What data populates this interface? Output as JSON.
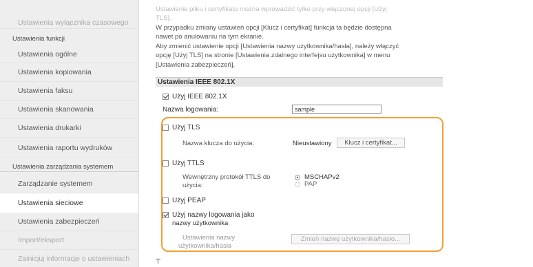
{
  "sidebar": {
    "items": [
      {
        "label": "Ustawienia wyłącznika czasowego",
        "state": "faint"
      },
      {
        "header": "Ustawienia funkcji"
      },
      {
        "label": "Ustawienia ogólne"
      },
      {
        "label": "Ustawienia kopiowania"
      },
      {
        "label": "Ustawienia faksu"
      },
      {
        "label": "Ustawienia skanowania"
      },
      {
        "label": "Ustawienia drukarki"
      },
      {
        "label": "Ustawienia raportu wydruków"
      },
      {
        "header": "Ustawienia zarządzania systemem"
      },
      {
        "label": "Zarządzanie systemem"
      },
      {
        "label": "Ustawienia sieciowe",
        "state": "active"
      },
      {
        "label": "Ustawienia zabezpieczeń"
      },
      {
        "label": "Import/eksport",
        "state": "faint"
      },
      {
        "label": "Zainicjuj informacje o ustawieniach",
        "state": "faint"
      }
    ]
  },
  "description": {
    "lines": [
      "Ustawienie pliku i certyfikatu można wprowadzić tylko przy włączonej opcji [Użyj",
      "TLS].",
      "W przypadku zmiany ustawień opcji [Klucz i certyfikat] funkcja ta będzie dostępna",
      "nawet po anulowaniu na tym ekranie.",
      "Aby zmienić ustawienie opcji [Ustawienia nazwy użytkownika/hasła], należy włączyć",
      "opcję [Użyj TLS] na stronie [Ustawienia zdalnego interfejsu użytkownika] w menu",
      "[Ustawienia zabezpieczeń]."
    ]
  },
  "section": {
    "title": "Ustawienia IEEE 802.1X"
  },
  "form": {
    "use_ieee": {
      "label": "Użyj IEEE 802.1X",
      "checked": true
    },
    "login_name": {
      "label": "Nazwa logowania:",
      "value": "sample"
    },
    "use_tls": {
      "label": "Użyj TLS",
      "checked": false
    },
    "key_name": {
      "label": "Nazwa klucza do użycia:",
      "value": "Nieustawiony",
      "button": "Klucz i certyfikat..."
    },
    "use_ttls": {
      "label": "Użyj TTLS",
      "checked": false
    },
    "ttls_protocol": {
      "label_line1": "Wewnętrzny protokół TTLS do",
      "label_line2": "użycia:",
      "options": [
        {
          "label": "MSCHAPv2",
          "checked": true
        },
        {
          "label": "PAP",
          "checked": false
        }
      ]
    },
    "use_peap": {
      "label": "Użyj PEAP",
      "checked": false
    },
    "use_login_as_user": {
      "label_line1": "Użyj nazwy logowania jako",
      "label_line2": "nazwy użytkownika",
      "checked": true
    },
    "user_settings": {
      "label_line1": "Ustawienia nazwy",
      "label_line2": "użytkownika/hasła",
      "button": "Zmień nazwę użytkownika/hasło..."
    }
  },
  "colors": {
    "highlight": "#f0a030"
  }
}
